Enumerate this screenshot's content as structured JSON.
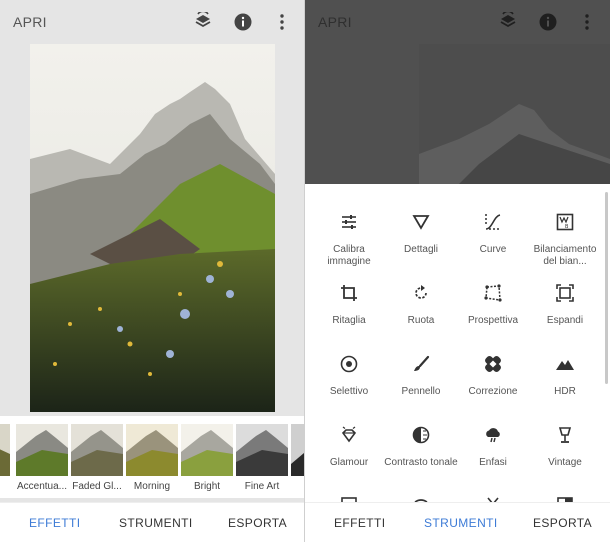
{
  "left": {
    "title": "APRI",
    "icons": [
      "layers-history-icon",
      "info-icon",
      "more-vertical-icon"
    ],
    "filters": [
      {
        "label": "Accentua..."
      },
      {
        "label": "Faded Gl..."
      },
      {
        "label": "Morning"
      },
      {
        "label": "Bright"
      },
      {
        "label": "Fine Art"
      }
    ],
    "nav": {
      "effetti": "EFFETTI",
      "strumenti": "STRUMENTI",
      "esporta": "ESPORTA"
    },
    "active_tab": "EFFETTI"
  },
  "right": {
    "title": "APRI",
    "tools": [
      {
        "label": "Calibra immagine",
        "icon": "sliders-icon"
      },
      {
        "label": "Dettagli",
        "icon": "triangle-details-icon"
      },
      {
        "label": "Curve",
        "icon": "curves-icon"
      },
      {
        "label": "Bilanciamento del bian...",
        "icon": "white-balance-icon"
      },
      {
        "label": "Ritaglia",
        "icon": "crop-icon"
      },
      {
        "label": "Ruota",
        "icon": "rotate-icon"
      },
      {
        "label": "Prospettiva",
        "icon": "perspective-icon"
      },
      {
        "label": "Espandi",
        "icon": "expand-icon"
      },
      {
        "label": "Selettivo",
        "icon": "selective-icon"
      },
      {
        "label": "Pennello",
        "icon": "brush-icon"
      },
      {
        "label": "Correzione",
        "icon": "healing-icon"
      },
      {
        "label": "HDR",
        "icon": "hdr-mountain-icon"
      },
      {
        "label": "Glamour",
        "icon": "glamour-diamond-icon"
      },
      {
        "label": "Contrasto tonale",
        "icon": "tonal-contrast-icon"
      },
      {
        "label": "Enfasi",
        "icon": "drama-cloud-icon"
      },
      {
        "label": "Vintage",
        "icon": "vintage-lamp-icon"
      }
    ],
    "nav": {
      "effetti": "EFFETTI",
      "strumenti": "STRUMENTI",
      "esporta": "ESPORTA"
    },
    "active_tab": "STRUMENTI"
  },
  "colors": {
    "accent": "#3d7bd6",
    "sheet": "#ffffff",
    "dim_overlay": "#505050"
  }
}
